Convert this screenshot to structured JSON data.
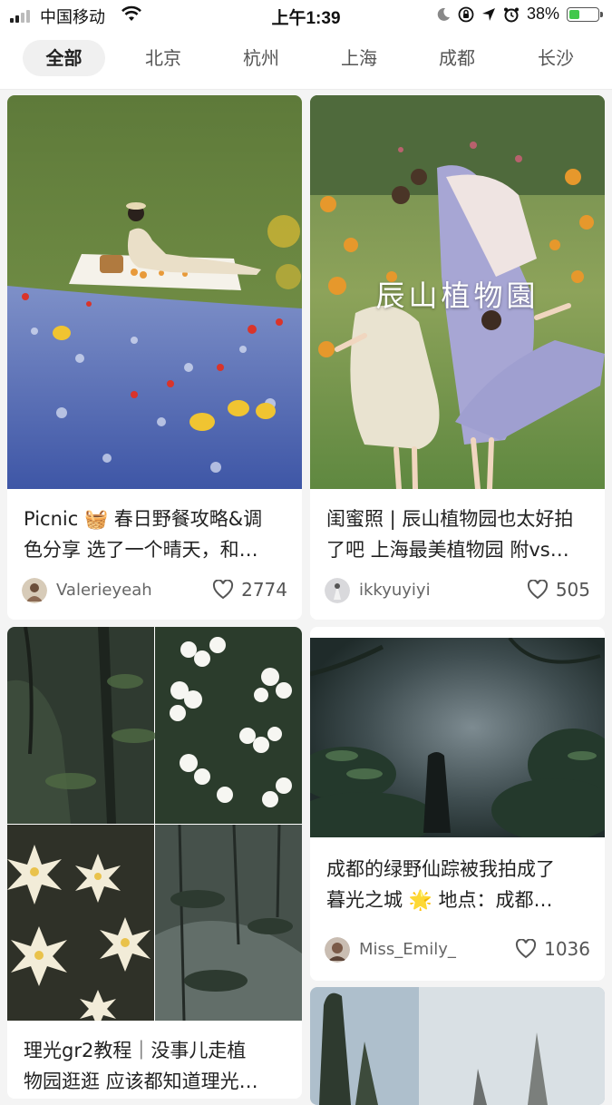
{
  "status_bar": {
    "carrier": "中国移动",
    "time": "上午1:39",
    "battery": "38%",
    "battery_level": 0.38
  },
  "tabs": [
    {
      "label": "全部",
      "active": true
    },
    {
      "label": "北京"
    },
    {
      "label": "杭州"
    },
    {
      "label": "上海"
    },
    {
      "label": "成都"
    },
    {
      "label": "长沙"
    }
  ],
  "cards": [
    {
      "title_line1": "Picnic 🧺 春日野餐攻略&调",
      "title_line2": "色分享 选了一个晴天，和…",
      "author": "Valerieyeah",
      "likes": "2774"
    },
    {
      "image_caption": "辰山植物園",
      "title_line1": "闺蜜照 | 辰山植物园也太好拍",
      "title_line2": "了吧 上海最美植物园 附vs…",
      "author": "ikkyuyiyi",
      "likes": "505"
    },
    {
      "title_line1": "成都的绿野仙踪被我拍成了",
      "title_line2": "暮光之城 🌟 地点：成都…",
      "author": "Miss_Emily_",
      "likes": "1036"
    },
    {
      "title_line1": "理光gr2教程｜没事儿走植",
      "title_line2": "物园逛逛 应该都知道理光…"
    }
  ]
}
